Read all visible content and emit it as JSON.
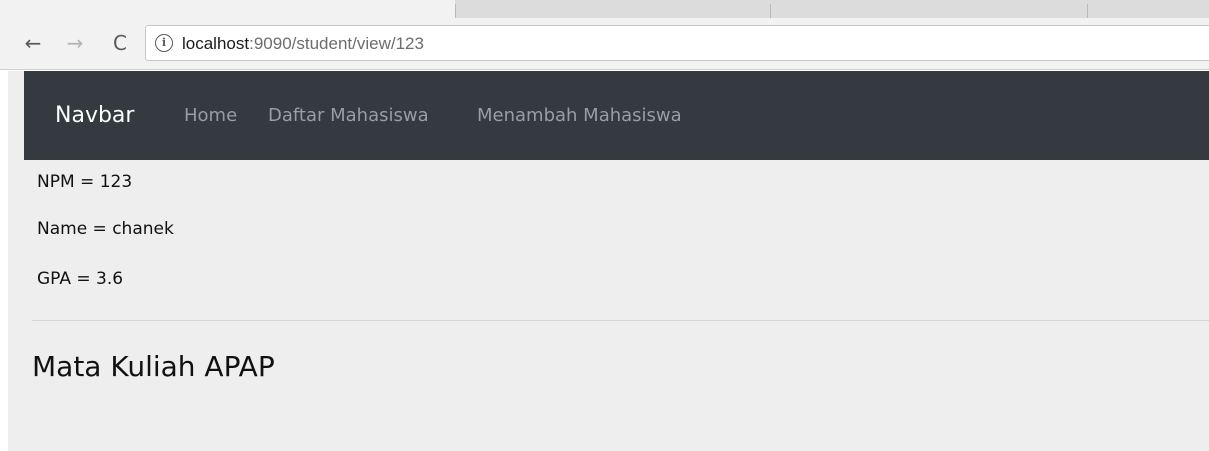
{
  "browser": {
    "back_glyph": "←",
    "forward_glyph": "→",
    "reload_glyph": "C",
    "info_glyph": "i",
    "url_host": "localhost",
    "url_rest": ":9090/student/view/123"
  },
  "navbar": {
    "brand": "Navbar",
    "links": [
      "Home",
      "Daftar Mahasiswa",
      "Menambah Mahasiswa"
    ],
    "background": "#343a40"
  },
  "student": {
    "npm": "NPM = 123",
    "name": "Name = chanek",
    "gpa": "GPA = 3.6"
  },
  "section": {
    "title": "Mata Kuliah APAP"
  }
}
